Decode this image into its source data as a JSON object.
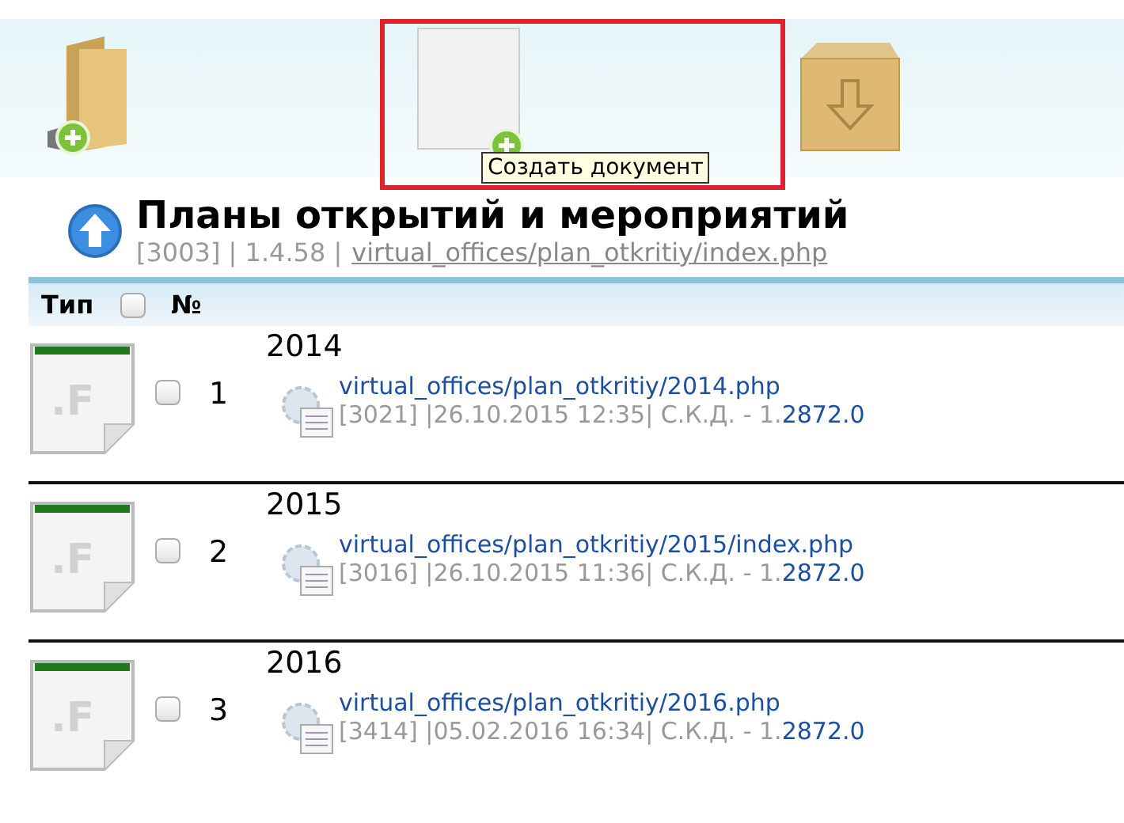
{
  "toolbar": {
    "tooltip": "Создать документ"
  },
  "page": {
    "title": "Планы открытий и мероприятий",
    "info": "[3003] | 1.4.58 |",
    "path": "virtual_offices/plan_otkritiy/index.php"
  },
  "table": {
    "columns": [
      "Тип",
      "№"
    ],
    "select_all": {
      "checked": false
    },
    "rows": [
      {
        "type_label": ".F",
        "number": "1",
        "title": "2014",
        "link": "virtual_offices/plan_otkritiy/2014.php",
        "meta": "[3021] |26.10.2015 12:35| С.К.Д. - 1.",
        "version": "2872.0",
        "checked": false
      },
      {
        "type_label": ".F",
        "number": "2",
        "title": "2015",
        "link": "virtual_offices/plan_otkritiy/2015/index.php",
        "meta": "[3016] |26.10.2015 11:36| С.К.Д. - 1.",
        "version": "2872.0",
        "checked": false
      },
      {
        "type_label": ".F",
        "number": "3",
        "title": "2016",
        "link": "virtual_offices/plan_otkritiy/2016.php",
        "meta": "[3414] |05.02.2016 16:34| С.К.Д. - 1.",
        "version": "2872.0",
        "checked": false
      }
    ]
  }
}
